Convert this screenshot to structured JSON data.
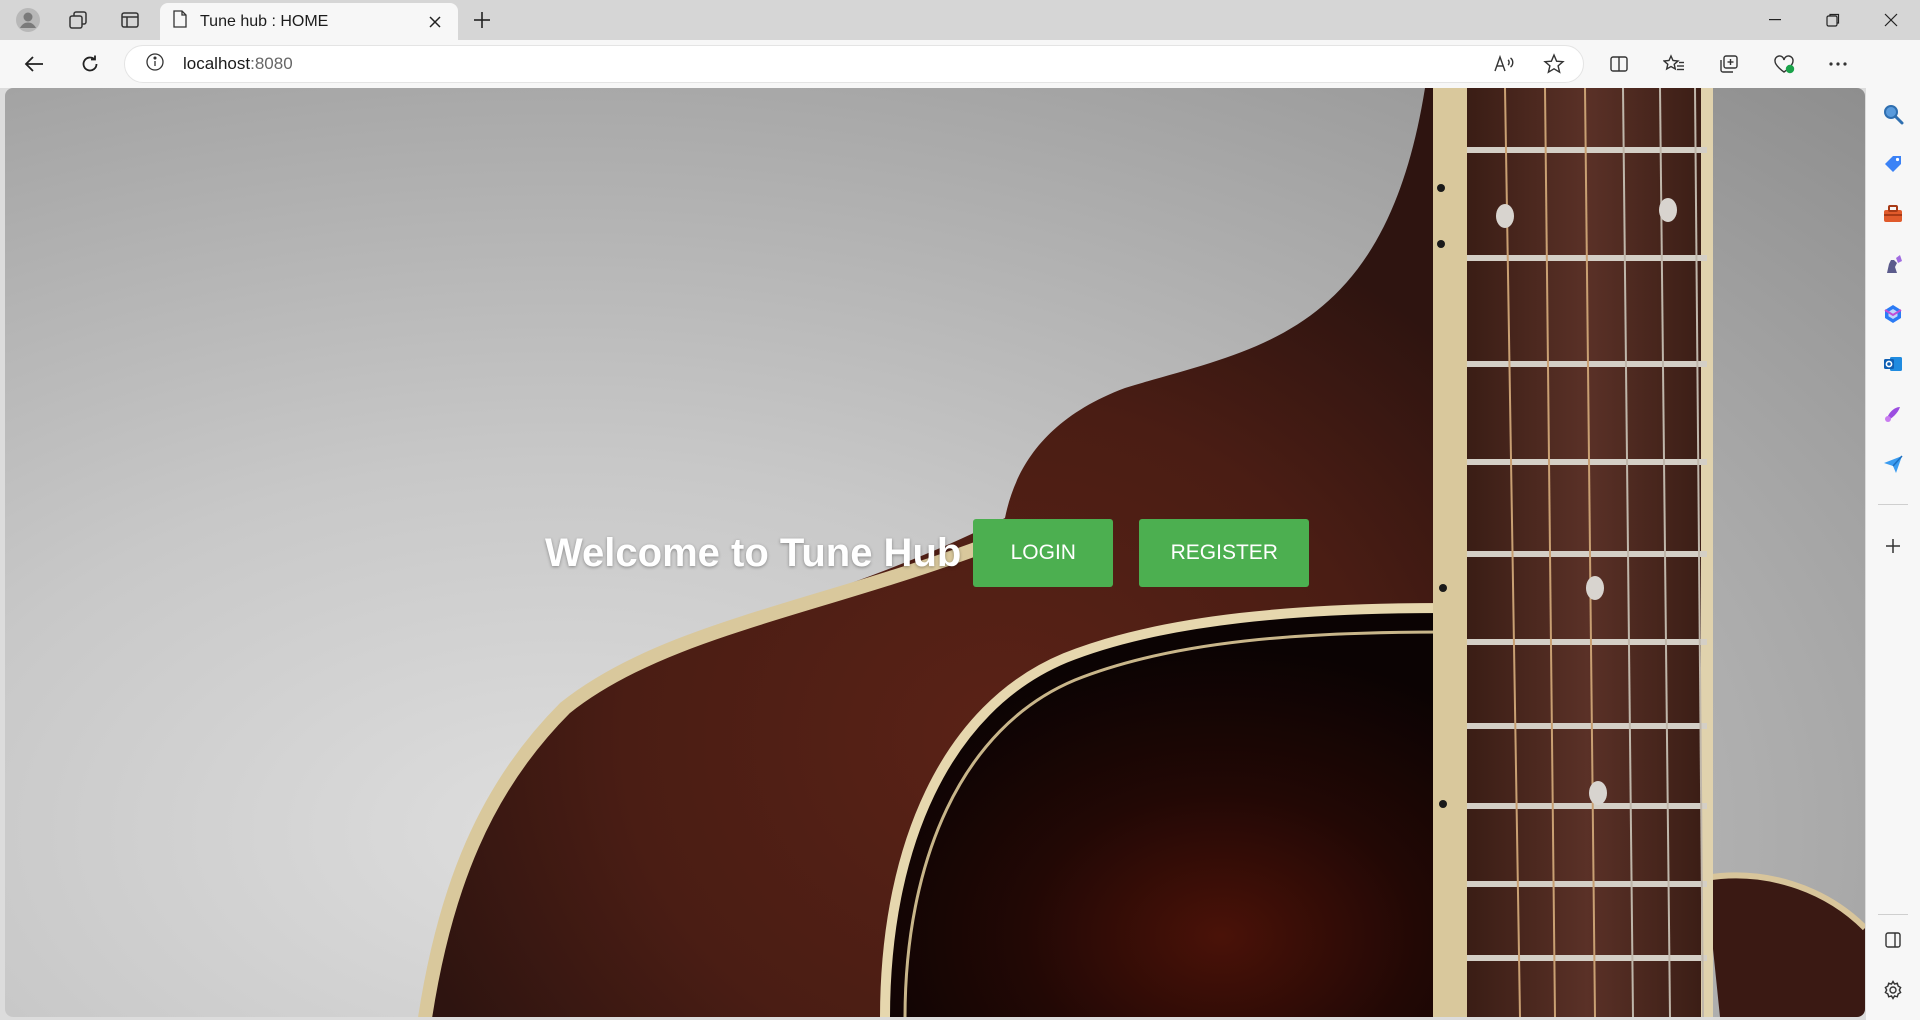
{
  "browser": {
    "tab_title": "Tune hub : HOME",
    "address_host": "localhost",
    "address_port": ":8080"
  },
  "page": {
    "heading": "Welcome to Tune Hub",
    "login_label": "LOGIN",
    "register_label": "REGISTER",
    "button_color": "#4caf50"
  },
  "icons": {
    "tabbar": [
      "profile-icon",
      "workspaces-icon",
      "tab-actions-icon",
      "page-icon",
      "close-icon",
      "plus-icon",
      "minimize-icon",
      "restore-icon",
      "close-window-icon"
    ],
    "toolbar": [
      "back-icon",
      "refresh-icon",
      "info-icon",
      "read-aloud-icon",
      "favorite-star-icon",
      "split-screen-icon",
      "favorites-icon",
      "collections-icon",
      "browser-essentials-icon",
      "more-icon",
      "copilot-icon"
    ],
    "sidebar": [
      "search-icon",
      "shopping-icon",
      "tools-icon",
      "games-icon",
      "microsoft365-icon",
      "outlook-icon",
      "designer-icon",
      "send-icon",
      "add-icon",
      "sidebar-toggle-icon",
      "settings-icon"
    ]
  }
}
